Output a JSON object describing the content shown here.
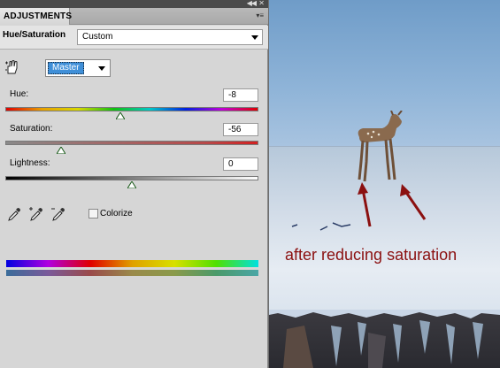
{
  "panel": {
    "tab_label": "ADJUSTMENTS",
    "adjustment_title": "Hue/Saturation",
    "preset_value": "Custom",
    "channel_value": "Master",
    "colorize_label": "Colorize",
    "colorize_checked": false
  },
  "sliders": {
    "hue": {
      "label": "Hue:",
      "value": "-8",
      "fraction": 0.456
    },
    "saturation": {
      "label": "Saturation:",
      "value": "-56",
      "fraction": 0.22
    },
    "lightness": {
      "label": "Lightness:",
      "value": "0",
      "fraction": 0.5
    }
  },
  "photo": {
    "caption": "after reducing saturation",
    "caption_color": "#8b1010"
  },
  "icons": [
    "panel-menu-icon",
    "target-hand-icon",
    "eyedropper-icon",
    "eyedropper-plus-icon",
    "eyedropper-minus-icon",
    "deer-image",
    "arrow-annotation-icon"
  ]
}
